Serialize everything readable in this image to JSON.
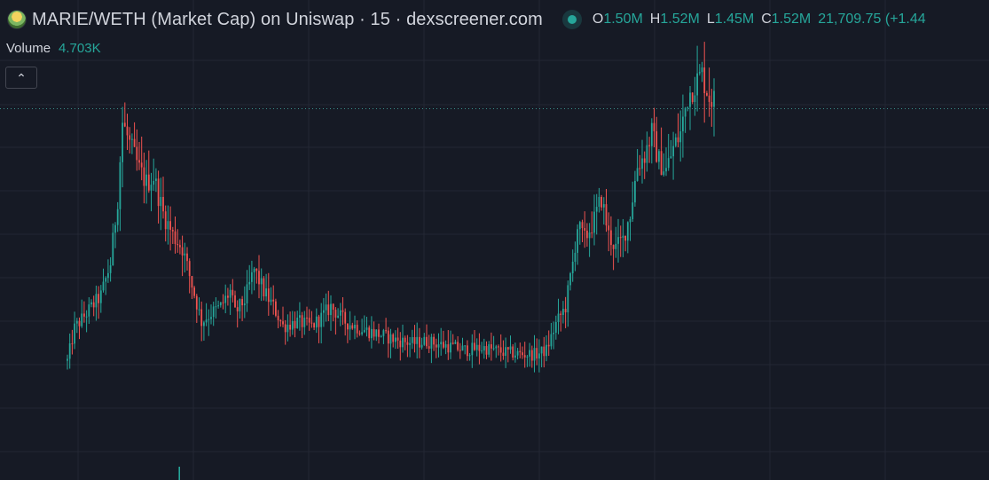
{
  "header": {
    "title": "MARIE/WETH (Market Cap) on Uniswap · 15 · dexscreener.com",
    "token_icon": "marie-token-icon",
    "status_color": "#26a69a"
  },
  "ohlc": {
    "o_label": "O",
    "o_value": "1.50M",
    "h_label": "H",
    "h_value": "1.52M",
    "l_label": "L",
    "l_value": "1.45M",
    "c_label": "C",
    "c_value": "1.52M",
    "change": "21,709.75 (+1.44"
  },
  "volume": {
    "label": "Volume",
    "value": "4.703K"
  },
  "controls": {
    "collapse_icon": "chevron-up-icon",
    "collapse_glyph": "⌃"
  },
  "colors": {
    "background": "#161a25",
    "grid": "#232733",
    "up": "#26a69a",
    "down": "#ef5350",
    "text": "#d1d4dc"
  },
  "chart_data": {
    "type": "candlestick",
    "interval": "15",
    "grid": true,
    "ylim": [
      0,
      1.8
    ],
    "last_price_line": 1.52,
    "series_anchors_close": [
      [
        0,
        0.3
      ],
      [
        3,
        0.45
      ],
      [
        8,
        0.52
      ],
      [
        14,
        0.6
      ],
      [
        18,
        0.75
      ],
      [
        21,
        1.05
      ],
      [
        23,
        1.4
      ],
      [
        26,
        1.3
      ],
      [
        30,
        1.18
      ],
      [
        33,
        1.12
      ],
      [
        36,
        1.15
      ],
      [
        40,
        0.98
      ],
      [
        44,
        0.88
      ],
      [
        48,
        0.82
      ],
      [
        52,
        0.65
      ],
      [
        56,
        0.48
      ],
      [
        60,
        0.52
      ],
      [
        64,
        0.55
      ],
      [
        68,
        0.62
      ],
      [
        70,
        0.52
      ],
      [
        74,
        0.58
      ],
      [
        78,
        0.72
      ],
      [
        82,
        0.62
      ],
      [
        86,
        0.55
      ],
      [
        90,
        0.46
      ],
      [
        96,
        0.48
      ],
      [
        102,
        0.46
      ],
      [
        106,
        0.5
      ],
      [
        110,
        0.55
      ],
      [
        116,
        0.48
      ],
      [
        122,
        0.45
      ],
      [
        128,
        0.43
      ],
      [
        136,
        0.4
      ],
      [
        144,
        0.38
      ],
      [
        150,
        0.39
      ],
      [
        158,
        0.37
      ],
      [
        166,
        0.35
      ],
      [
        174,
        0.36
      ],
      [
        182,
        0.34
      ],
      [
        190,
        0.33
      ],
      [
        196,
        0.33
      ],
      [
        200,
        0.35
      ],
      [
        204,
        0.47
      ],
      [
        208,
        0.55
      ],
      [
        211,
        0.75
      ],
      [
        213,
        0.92
      ],
      [
        216,
        0.86
      ],
      [
        220,
        0.95
      ],
      [
        223,
        1.05
      ],
      [
        226,
        0.88
      ],
      [
        229,
        0.82
      ],
      [
        232,
        0.86
      ],
      [
        235,
        0.98
      ],
      [
        238,
        1.2
      ],
      [
        241,
        1.25
      ],
      [
        244,
        1.35
      ],
      [
        247,
        1.22
      ],
      [
        250,
        1.18
      ],
      [
        253,
        1.28
      ],
      [
        256,
        1.35
      ],
      [
        259,
        1.52
      ],
      [
        262,
        1.58
      ],
      [
        265,
        1.62
      ],
      [
        268,
        1.52
      ],
      [
        270,
        1.5
      ]
    ],
    "volume_spike_index": 42
  }
}
